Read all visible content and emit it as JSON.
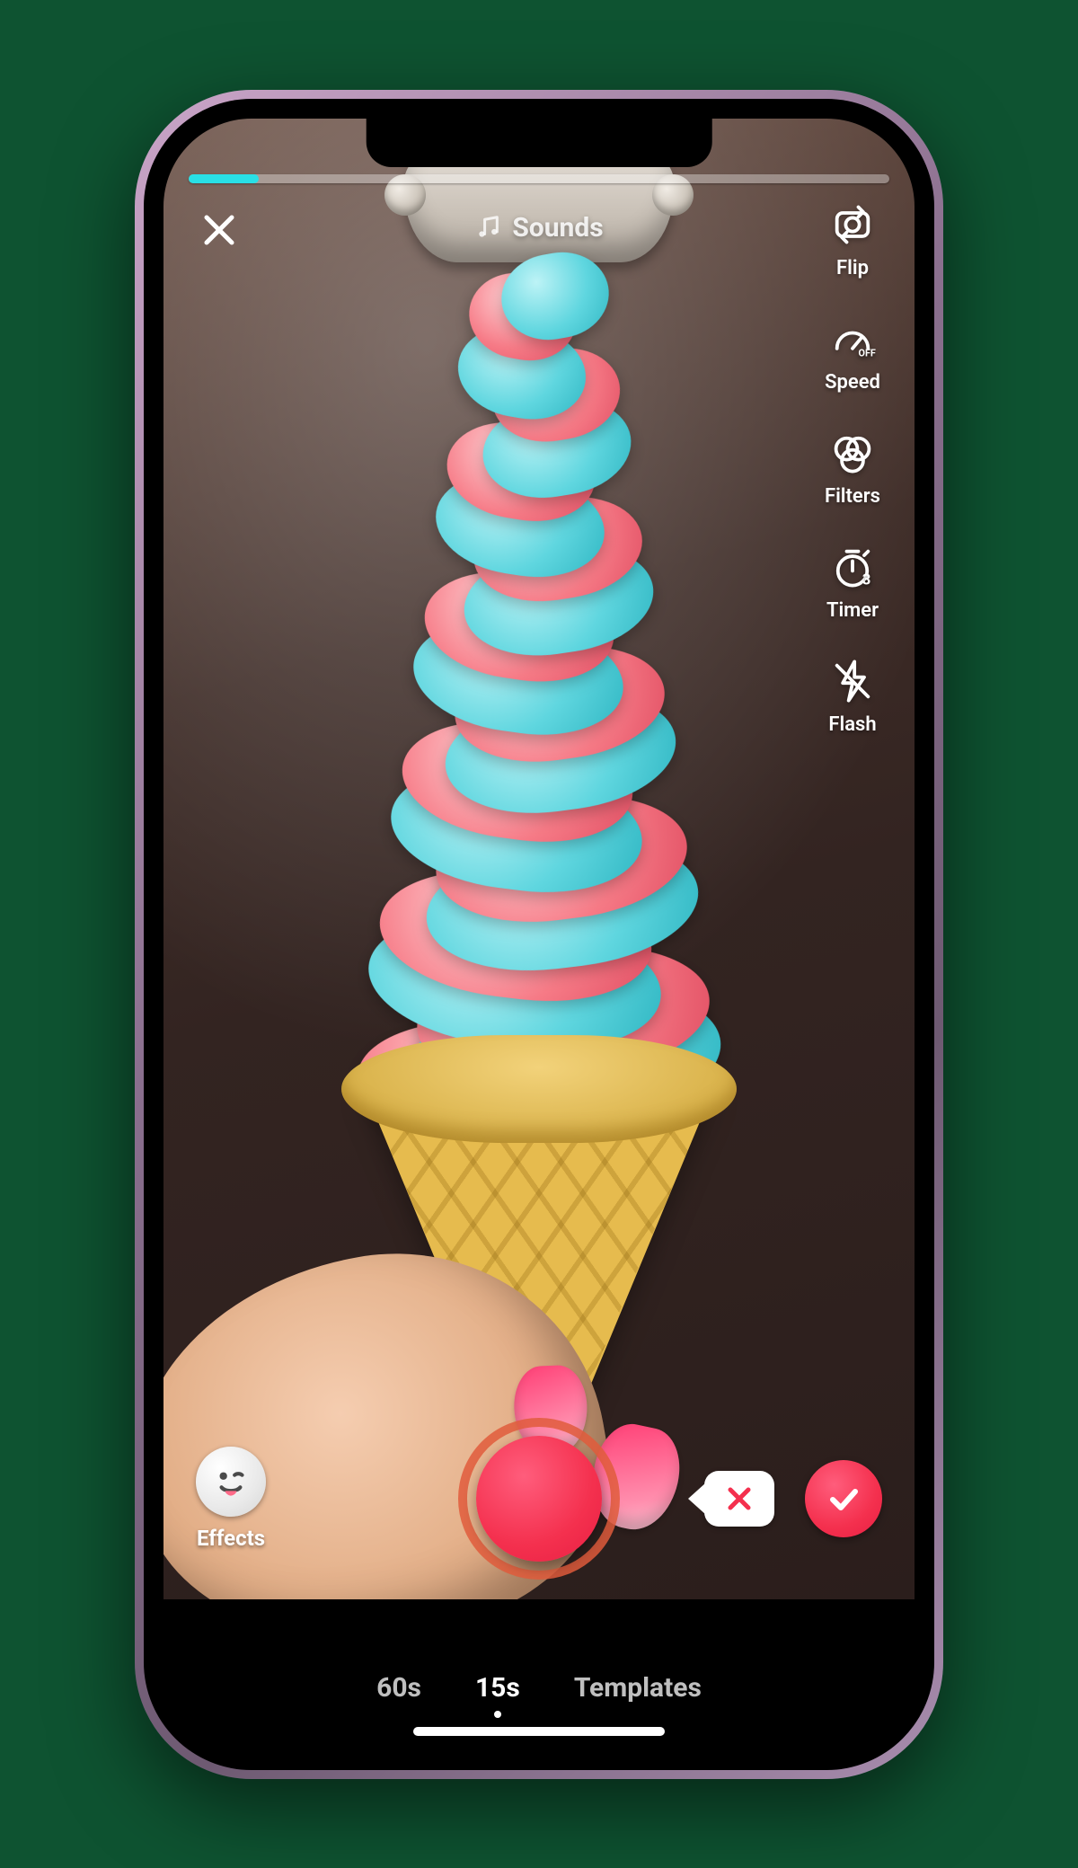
{
  "header": {
    "sounds_label": "Sounds",
    "progress_percent": 10
  },
  "side_tools": {
    "flip": "Flip",
    "speed": "Speed",
    "filters": "Filters",
    "timer": "Timer",
    "timer_badge": "3",
    "flash": "Flash"
  },
  "bottom": {
    "effects_label": "Effects"
  },
  "modes": {
    "items": [
      "60s",
      "15s",
      "Templates"
    ],
    "active_index": 1
  },
  "colors": {
    "accent_red": "#f4304e",
    "accent_teal": "#29e0e6"
  }
}
